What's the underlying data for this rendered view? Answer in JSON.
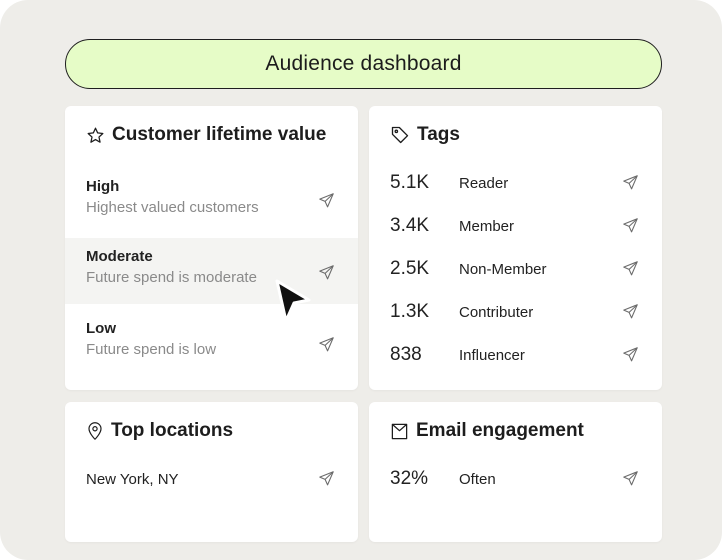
{
  "title": "Audience dashboard",
  "colors": {
    "accent_pill": "#e6fcc7",
    "card": "#ffffff",
    "background": "#eeede9"
  },
  "clv": {
    "title": "Customer lifetime value",
    "icon": "star-icon",
    "items": [
      {
        "title": "High",
        "subtitle": "Highest valued customers"
      },
      {
        "title": "Moderate",
        "subtitle": "Future spend is moderate"
      },
      {
        "title": "Low",
        "subtitle": "Future spend is low"
      }
    ]
  },
  "tags": {
    "title": "Tags",
    "icon": "tag-icon",
    "rows": [
      {
        "count": "5.1K",
        "label": "Reader"
      },
      {
        "count": "3.4K",
        "label": "Member"
      },
      {
        "count": "2.5K",
        "label": "Non-Member"
      },
      {
        "count": "1.3K",
        "label": "Contributer"
      },
      {
        "count": "838",
        "label": "Influencer"
      }
    ]
  },
  "locations": {
    "title": "Top locations",
    "icon": "location-pin-icon",
    "rows": [
      {
        "label": "New York, NY"
      }
    ]
  },
  "email": {
    "title": "Email engagement",
    "icon": "envelope-icon",
    "rows": [
      {
        "count": "32%",
        "label": "Often"
      }
    ]
  }
}
